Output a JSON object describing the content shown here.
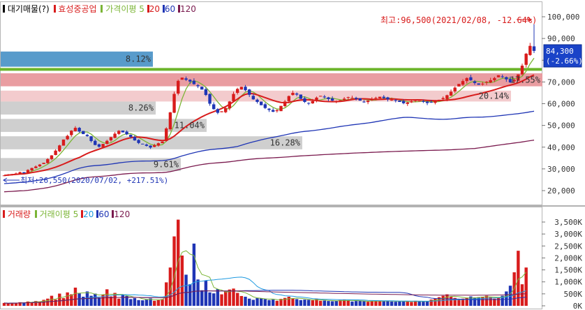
{
  "price_legend": {
    "title": "대기매물(?)",
    "stock": "효성중공업",
    "ma_label": "가격이평",
    "ma_periods": [
      "5",
      "20",
      "60",
      "120"
    ],
    "ma_colors": {
      "5": "#7bb536",
      "20": "#d81c1c",
      "60": "#1f35b5",
      "120": "#7a1a4e"
    }
  },
  "volume_legend": {
    "title": "거래량",
    "ma_label": "거래이평",
    "ma_periods": [
      "5",
      "20",
      "60",
      "120"
    ]
  },
  "annotations": {
    "high": "최고:96,500(2021/02/08, -12.64%)",
    "low": "최저:26,550(2020/07/02, +217.51%)",
    "current_price": "84,300",
    "current_change": "(-2.66%)"
  },
  "price_axis": {
    "ticks": [
      "100,000",
      "90,000",
      "80,000",
      "70,000",
      "60,000",
      "50,000",
      "40,000",
      "30,000",
      "20,000"
    ]
  },
  "volume_axis": {
    "ticks": [
      "3,500K",
      "3,000K",
      "2,500K",
      "2,000K",
      "1,500K",
      "1,000K",
      "500K",
      "0K"
    ]
  },
  "chart_data": {
    "type": "bar",
    "title": "대기매물(?)",
    "price_range": [
      15000,
      105000
    ],
    "volume_range": [
      0,
      3800000
    ],
    "supply_bands": [
      {
        "low": 77000,
        "high": 84000,
        "pct": "8.12%",
        "color": "#4f96c8"
      },
      {
        "low": 68000,
        "high": 74000,
        "pct": "17.55%",
        "color": "#e8989c"
      },
      {
        "low": 55000,
        "high": 61000,
        "pct": "8.26%",
        "color": "#cccccc"
      },
      {
        "low": 47000,
        "high": 53000,
        "pct": "11.04%",
        "color": "#cccccc"
      },
      {
        "low": 39000,
        "high": 45000,
        "pct": "16.28%",
        "color": "#cccccc"
      },
      {
        "low": 29000,
        "high": 35000,
        "pct": "9.61%",
        "color": "#cccccc"
      },
      {
        "low": 61000,
        "high": 66000,
        "pct": "20.14%",
        "color": "#e8989c"
      }
    ],
    "resistance_level": 75800,
    "close": [
      27000,
      27300,
      27600,
      27900,
      28500,
      28000,
      29500,
      30400,
      31100,
      32000,
      32800,
      34500,
      36200,
      38400,
      40800,
      43500,
      45200,
      47600,
      48900,
      47200,
      46000,
      45100,
      42800,
      41000,
      40200,
      41500,
      42900,
      44600,
      46200,
      47500,
      46800,
      45900,
      44700,
      43100,
      41900,
      41300,
      40600,
      39800,
      40900,
      41800,
      42600,
      48600,
      56000,
      64500,
      70500,
      72000,
      71000,
      70200,
      69000,
      68000,
      66500,
      64000,
      60000,
      57500,
      55800,
      56500,
      58000,
      61000,
      64500,
      66800,
      67800,
      66200,
      64100,
      62000,
      60800,
      59300,
      58000,
      57100,
      56300,
      57000,
      59000,
      61000,
      63500,
      65000,
      64200,
      62200,
      60800,
      60300,
      61200,
      62800,
      63600,
      62900,
      62100,
      61400,
      61000,
      61600,
      62300,
      63000,
      62700,
      62200,
      61400,
      60900,
      61400,
      62000,
      62700,
      63200,
      62600,
      62000,
      61800,
      61300,
      60800,
      60200,
      60600,
      61100,
      61600,
      61300,
      60800,
      60300,
      60700,
      61200,
      61800,
      62600,
      63900,
      65500,
      67400,
      69100,
      70400,
      71800,
      70800,
      69500,
      68700,
      69200,
      70100,
      70800,
      71800,
      73100,
      72400,
      71200,
      69800,
      70900,
      73500,
      77500,
      83000,
      86600,
      84300
    ],
    "volume_k": [
      120,
      90,
      130,
      110,
      150,
      140,
      180,
      160,
      200,
      180,
      250,
      300,
      420,
      260,
      510,
      320,
      560,
      480,
      760,
      520,
      380,
      600,
      420,
      510,
      350,
      460,
      690,
      390,
      540,
      300,
      470,
      410,
      280,
      320,
      240,
      230,
      260,
      310,
      210,
      240,
      280,
      980,
      1600,
      2900,
      3600,
      2100,
      1300,
      900,
      2600,
      1100,
      650,
      1050,
      560,
      520,
      700,
      480,
      600,
      680,
      720,
      540,
      410,
      380,
      300,
      250,
      320,
      310,
      280,
      240,
      260,
      210,
      290,
      330,
      380,
      320,
      280,
      240,
      260,
      250,
      230,
      280,
      210,
      220,
      200,
      190,
      210,
      240,
      260,
      220,
      180,
      200,
      210,
      190,
      170,
      200,
      220,
      190,
      200,
      210,
      180,
      170,
      190,
      200,
      180,
      160,
      210,
      190,
      180,
      200,
      260,
      300,
      360,
      420,
      480,
      390,
      330,
      270,
      300,
      340,
      390,
      350,
      360,
      380,
      420,
      360,
      300,
      330,
      420,
      600,
      840,
      1400,
      2300,
      900,
      1600
    ]
  }
}
